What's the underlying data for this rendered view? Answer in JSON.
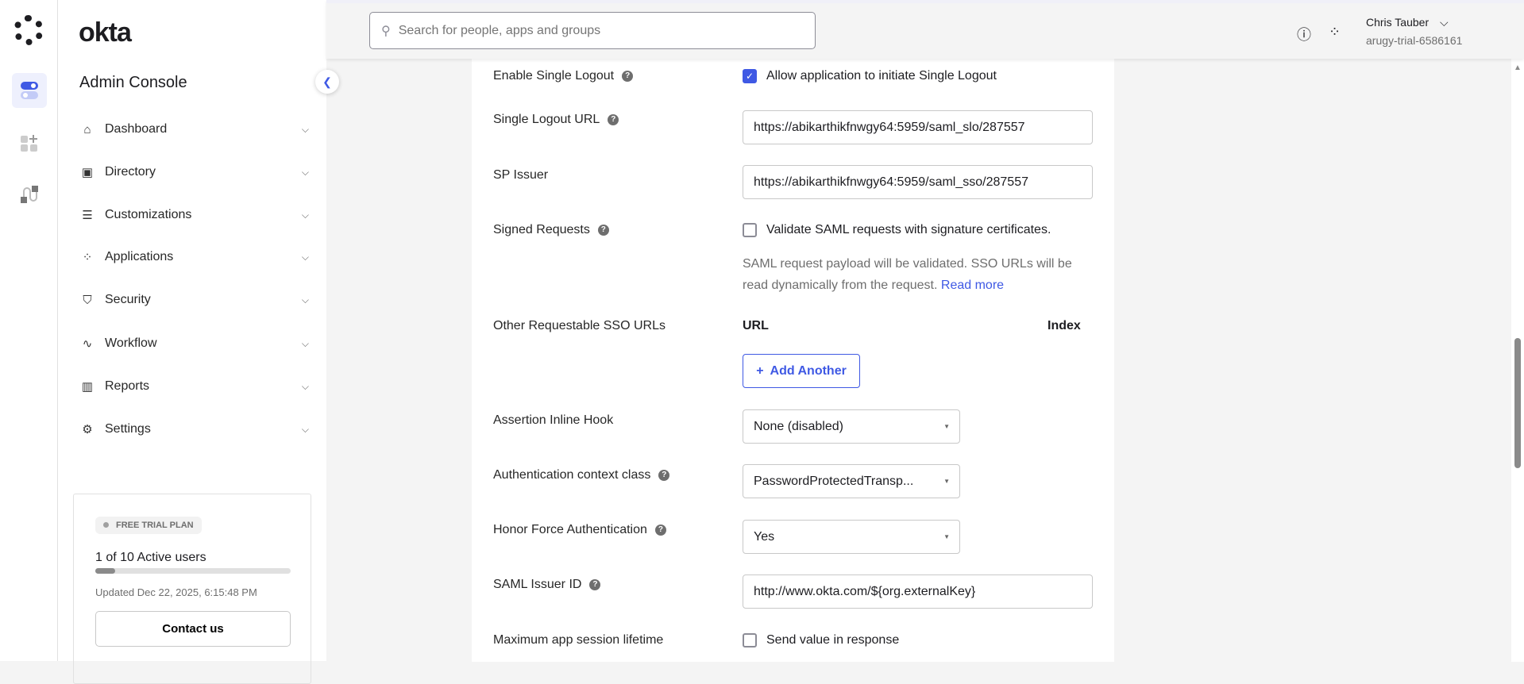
{
  "rail": {
    "items": [
      "toggle-apps",
      "add-apps",
      "workflow"
    ]
  },
  "sidebar": {
    "logo": "okta",
    "title": "Admin Console",
    "items": [
      {
        "label": "Dashboard",
        "icon": "⌂"
      },
      {
        "label": "Directory",
        "icon": "▣"
      },
      {
        "label": "Customizations",
        "icon": "☰"
      },
      {
        "label": "Applications",
        "icon": "⁘"
      },
      {
        "label": "Security",
        "icon": "⛉"
      },
      {
        "label": "Workflow",
        "icon": "∿"
      },
      {
        "label": "Reports",
        "icon": "▥"
      },
      {
        "label": "Settings",
        "icon": "⚙"
      }
    ],
    "plan": {
      "badge": "FREE TRIAL PLAN",
      "users": "1 of 10 Active users",
      "progress": 0.1,
      "updated": "Updated Dec 22, 2025, 6:15:48 PM",
      "contact": "Contact us"
    }
  },
  "header": {
    "search_placeholder": "Search for people, apps and groups",
    "user_name": "Chris Tauber",
    "org": "arugy-trial-6586161"
  },
  "form": {
    "single_logout": {
      "label": "Enable Single Logout",
      "checkbox": "Allow application to initiate Single Logout",
      "checked": true
    },
    "slo_url": {
      "label": "Single Logout URL",
      "value": "https://abikarthikfnwgy64:5959/saml_slo/287557"
    },
    "sp_issuer": {
      "label": "SP Issuer",
      "value": "https://abikarthikfnwgy64:5959/saml_sso/287557"
    },
    "signed_requests": {
      "label": "Signed Requests",
      "checkbox": "Validate SAML requests with signature certificates.",
      "checked": false,
      "help": "SAML request payload will be validated. SSO URLs will be read dynamically from the request.",
      "read_more": "Read more"
    },
    "other_sso": {
      "label": "Other Requestable SSO URLs",
      "col_url": "URL",
      "col_index": "Index",
      "add": "Add Another"
    },
    "inline_hook": {
      "label": "Assertion Inline Hook",
      "value": "None (disabled)"
    },
    "auth_context": {
      "label": "Authentication context class",
      "value": "PasswordProtectedTransp..."
    },
    "force_auth": {
      "label": "Honor Force Authentication",
      "value": "Yes"
    },
    "issuer_id": {
      "label": "SAML Issuer ID",
      "value": "http://www.okta.com/${org.externalKey}"
    },
    "max_session": {
      "label": "Maximum app session lifetime",
      "checkbox": "Send value in response",
      "checked": false
    }
  }
}
